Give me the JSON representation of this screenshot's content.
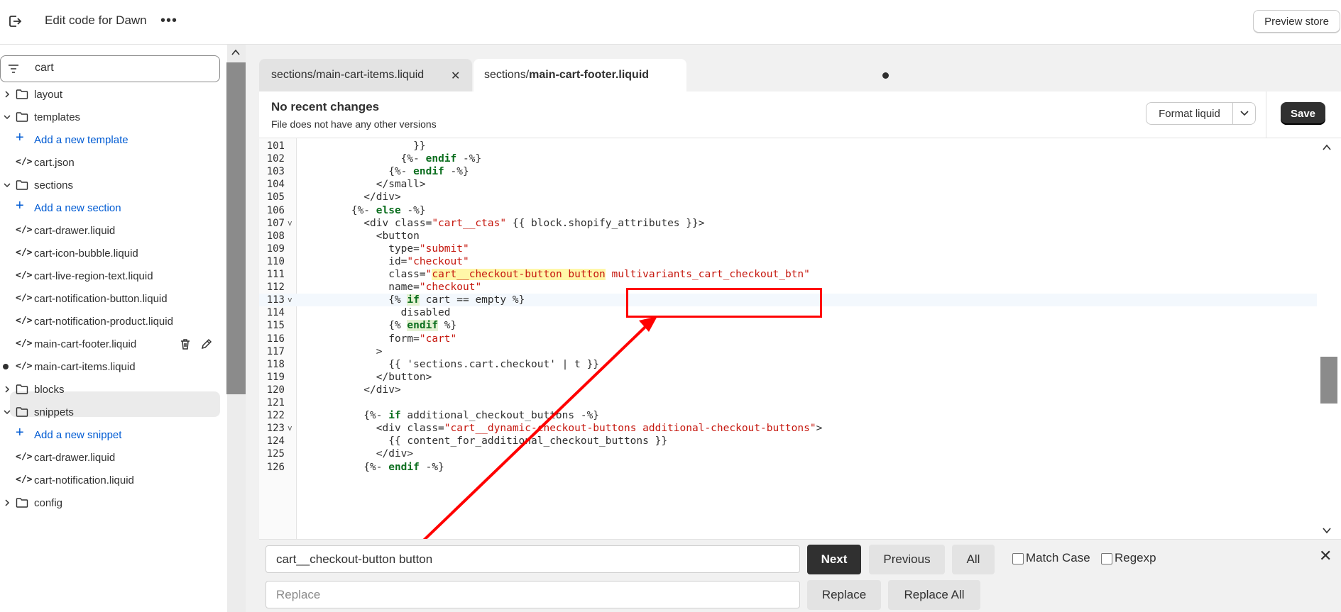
{
  "topbar": {
    "title": "Edit code for Dawn",
    "more": "•••",
    "preview_label": "Preview store"
  },
  "sidebar": {
    "search_value": "cart",
    "items": [
      {
        "type": "folder",
        "label": "layout",
        "expanded": false
      },
      {
        "type": "folder",
        "label": "templates",
        "expanded": true
      },
      {
        "type": "add",
        "label": "Add a new template"
      },
      {
        "type": "file",
        "label": "cart.json"
      },
      {
        "type": "folder",
        "label": "sections",
        "expanded": true
      },
      {
        "type": "add",
        "label": "Add a new section"
      },
      {
        "type": "file",
        "label": "cart-drawer.liquid"
      },
      {
        "type": "file",
        "label": "cart-icon-bubble.liquid"
      },
      {
        "type": "file",
        "label": "cart-live-region-text.liquid"
      },
      {
        "type": "file",
        "label": "cart-notification-button.liquid"
      },
      {
        "type": "file",
        "label": "cart-notification-product.liquid"
      },
      {
        "type": "file",
        "label": "main-cart-footer.liquid",
        "selected": true
      },
      {
        "type": "file",
        "label": "main-cart-items.liquid",
        "modified": true
      },
      {
        "type": "folder",
        "label": "blocks",
        "expanded": false
      },
      {
        "type": "folder",
        "label": "snippets",
        "expanded": true
      },
      {
        "type": "add",
        "label": "Add a new snippet"
      },
      {
        "type": "file",
        "label": "cart-drawer.liquid"
      },
      {
        "type": "file",
        "label": "cart-notification.liquid"
      },
      {
        "type": "folder",
        "label": "config",
        "expanded": false
      }
    ]
  },
  "tabs": [
    {
      "label": "sections/main-cart-items.liquid"
    },
    {
      "prefix": "sections/",
      "name": "main-cart-footer.liquid",
      "modified": true
    }
  ],
  "header": {
    "title": "No recent changes",
    "subtitle": "File does not have any other versions",
    "format_label": "Format liquid",
    "save_label": "Save"
  },
  "code_lines": [
    {
      "n": "101",
      "text": "                  }}"
    },
    {
      "n": "102",
      "text": "                {%- endif -%}"
    },
    {
      "n": "103",
      "text": "              {%- endif -%}"
    },
    {
      "n": "104",
      "text": "            </small>"
    },
    {
      "n": "105",
      "text": "          </div>"
    },
    {
      "n": "106",
      "text": "        {%- else -%}"
    },
    {
      "n": "107",
      "text": "          <div class=\"cart__ctas\" {{ block.shopify_attributes }}>",
      "fold": true
    },
    {
      "n": "108",
      "text": "            <button"
    },
    {
      "n": "109",
      "text": "              type=\"submit\""
    },
    {
      "n": "110",
      "text": "              id=\"checkout\""
    },
    {
      "n": "111",
      "text": "              class=\"cart__checkout-button button multivariants_cart_checkout_btn\""
    },
    {
      "n": "112",
      "text": "              name=\"checkout\""
    },
    {
      "n": "113",
      "text": "              {% if cart == empty %}",
      "fold": true,
      "active": true
    },
    {
      "n": "114",
      "text": "                disabled"
    },
    {
      "n": "115",
      "text": "              {% endif %}"
    },
    {
      "n": "116",
      "text": "              form=\"cart\""
    },
    {
      "n": "117",
      "text": "            >"
    },
    {
      "n": "118",
      "text": "              {{ 'sections.cart.checkout' | t }}"
    },
    {
      "n": "119",
      "text": "            </button>"
    },
    {
      "n": "120",
      "text": "          </div>"
    },
    {
      "n": "121",
      "text": ""
    },
    {
      "n": "122",
      "text": "          {%- if additional_checkout_buttons -%}"
    },
    {
      "n": "123",
      "text": "            <div class=\"cart__dynamic-checkout-buttons additional-checkout-buttons\">",
      "fold": true
    },
    {
      "n": "124",
      "text": "              {{ content_for_additional_checkout_buttons }}"
    },
    {
      "n": "125",
      "text": "            </div>"
    },
    {
      "n": "126",
      "text": "          {%- endif -%}"
    }
  ],
  "find": {
    "search_value": "cart__checkout-button button",
    "replace_placeholder": "Replace",
    "next_label": "Next",
    "previous_label": "Previous",
    "all_label": "All",
    "match_case_label": "Match Case",
    "regexp_label": "Regexp",
    "replace_label": "Replace",
    "replace_all_label": "Replace All"
  },
  "colors": {
    "accent_blue": "#005bd3",
    "annotation_red": "#ff0000",
    "save_bg": "#303030"
  }
}
